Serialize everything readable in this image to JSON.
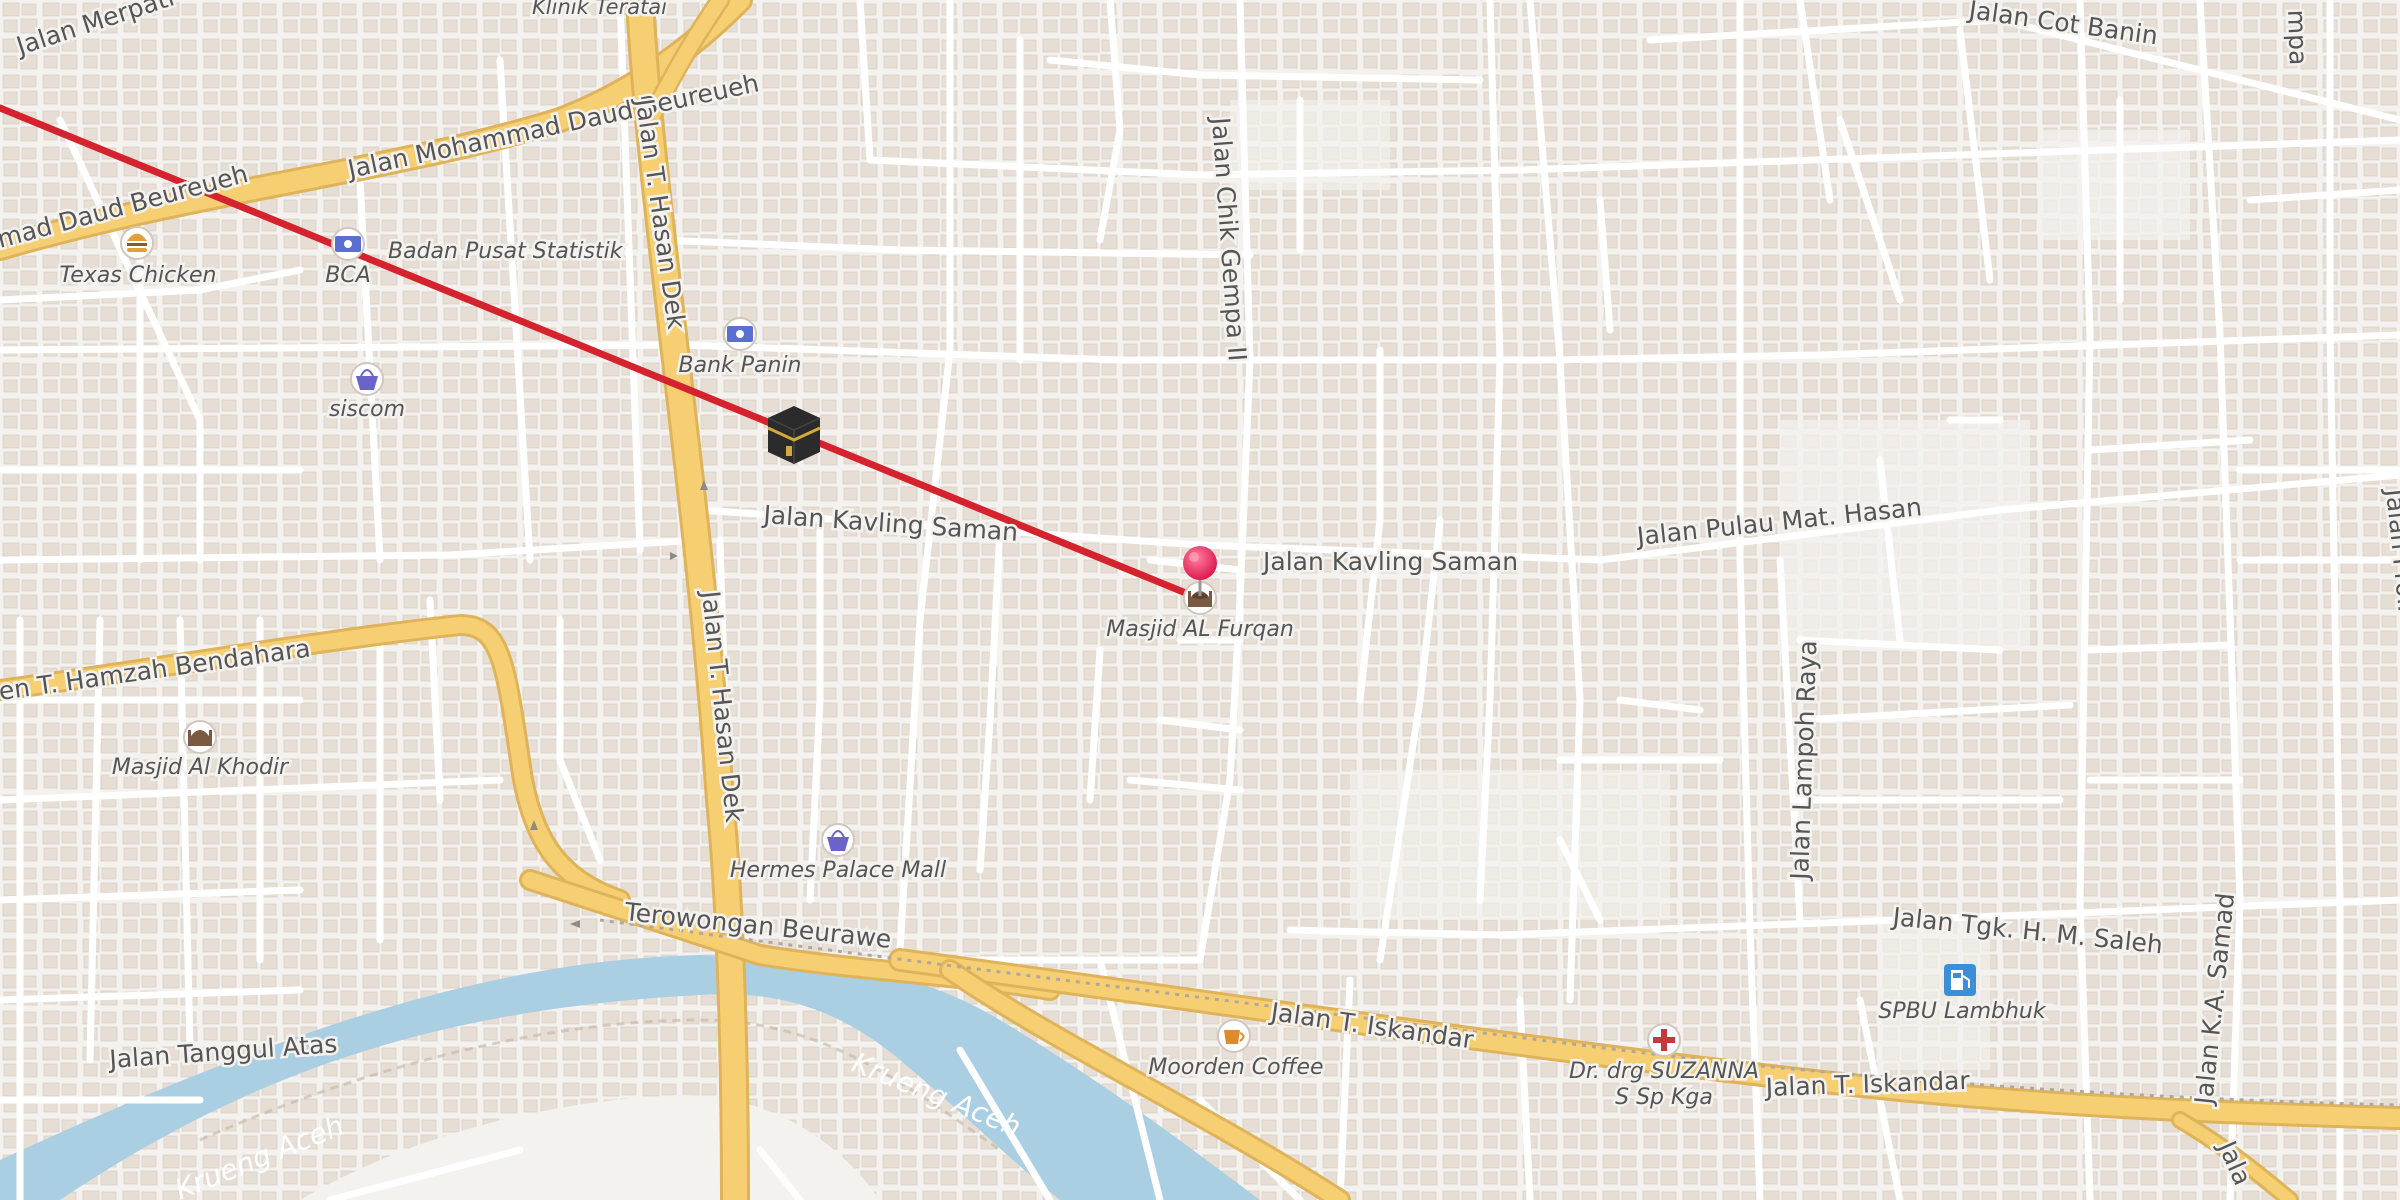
{
  "map": {
    "streets": [
      {
        "id": "merpati",
        "name": "Jalan Merpati"
      },
      {
        "id": "klinik",
        "name": "Klinik Teratai"
      },
      {
        "id": "daud_beureueh",
        "name": "Jalan Mohammad Daud Beureueh"
      },
      {
        "id": "daud_beureueh_left",
        "name": "mad Daud Beureueh"
      },
      {
        "id": "daud_beureueh_upper",
        "name": "Jalan Mohammad Daud Beureueh"
      },
      {
        "id": "hasan_dek_upper",
        "name": "Jalan T. Hasan Dek"
      },
      {
        "id": "hasan_dek_lower",
        "name": "Jalan T. Hasan Dek"
      },
      {
        "id": "chik_gempa",
        "name": "Jalan Chik Gempa II"
      },
      {
        "id": "cot_banin",
        "name": "Jalan Cot Banin"
      },
      {
        "id": "kavling_saman_w",
        "name": "Jalan Kavling Saman"
      },
      {
        "id": "kavling_saman_e",
        "name": "Jalan Kavling Saman"
      },
      {
        "id": "pulau_mat_hasan",
        "name": "Jalan Pulau Mat. Hasan"
      },
      {
        "id": "hamzah",
        "name": "en T. Hamzah Bendahara"
      },
      {
        "id": "lampoh_raya",
        "name": "Jalan Lampoh Raya"
      },
      {
        "id": "terowongan",
        "name": "Terowongan Beurawe"
      },
      {
        "id": "tgk_saleh",
        "name": "Jalan Tgk. H. M. Saleh"
      },
      {
        "id": "iskandar_1",
        "name": "Jalan T. Iskandar"
      },
      {
        "id": "iskandar_2",
        "name": "Jalan T. Iskandar"
      },
      {
        "id": "tanggul",
        "name": "Jalan Tanggul Atas"
      },
      {
        "id": "ka_samad",
        "name": "Jalan K.A. Samad"
      },
      {
        "id": "syiah",
        "name": "Jalan Prof. Dr. Ir. Syiah Kuala"
      },
      {
        "id": "mpa",
        "name": "mpa"
      },
      {
        "id": "jalan_bottom",
        "name": "Jala"
      }
    ],
    "rivers": [
      {
        "id": "krueng_1",
        "name": "Krueng Aceh"
      },
      {
        "id": "krueng_2",
        "name": "Krueng Aceh"
      }
    ],
    "pois": [
      {
        "id": "texas",
        "name": "Texas Chicken",
        "icon": "burger-icon"
      },
      {
        "id": "bca",
        "name": "BCA",
        "icon": "bank-icon"
      },
      {
        "id": "bps",
        "name": "Badan Pusat Statistik",
        "icon": "none"
      },
      {
        "id": "panin",
        "name": "Bank Panin",
        "icon": "bank-icon"
      },
      {
        "id": "siscom",
        "name": "siscom",
        "icon": "shopping-basket-icon"
      },
      {
        "id": "masjid_khodir",
        "name": "Masjid Al Khodir",
        "icon": "mosque-icon"
      },
      {
        "id": "hermes",
        "name": "Hermes Palace Mall",
        "icon": "shopping-basket-icon"
      },
      {
        "id": "masjid_furqan",
        "name": "Masjid AL Furqan",
        "icon": "mosque-icon"
      },
      {
        "id": "moorden",
        "name": "Moorden Coffee",
        "icon": "coffee-cup-icon"
      },
      {
        "id": "suzanna_1",
        "name": "Dr. drg SUZANNA",
        "icon": "medical-cross-icon"
      },
      {
        "id": "suzanna_2",
        "name": "S Sp Kga",
        "icon": "none"
      },
      {
        "id": "spbu",
        "name": "SPBU Lambhuk",
        "icon": "fuel-pump-icon"
      }
    ],
    "markers": [
      {
        "id": "kaaba",
        "icon": "kaaba-icon"
      },
      {
        "id": "pin",
        "icon": "location-pin-icon",
        "color": "#e8245c"
      }
    ],
    "colors": {
      "land": "#f4f2ef",
      "building": "#e5ddd4",
      "minor_road": "#ffffff",
      "major_road": "#f6cf73",
      "water": "#aacfe3",
      "label": "#555555",
      "route_line": "#d4232f",
      "pin": "#e8245c"
    }
  }
}
